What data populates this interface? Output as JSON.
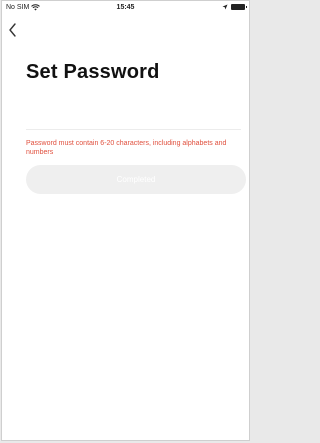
{
  "status_bar": {
    "carrier": "No SIM",
    "time": "15:45",
    "icons": [
      "wifi-icon",
      "location-icon",
      "battery-icon"
    ]
  },
  "navigation": {
    "back_icon": "chevron-left-icon"
  },
  "page": {
    "title": "Set Password",
    "hint": "Password must contain 6-20 characters, including alphabets and numbers",
    "completed_label": "Completed"
  },
  "colors": {
    "hint": "#e0503e",
    "button_disabled_bg": "#efefef",
    "button_text": "#ffffff"
  }
}
